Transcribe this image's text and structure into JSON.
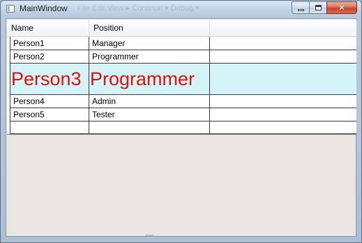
{
  "window": {
    "title": "MainWindow",
    "ghost_toolbar_text": "File  Edit  View  ▸ Continue ▾ Debug ▾",
    "controls": {
      "minimize": "minimize",
      "maximize": "maximize",
      "close": "✕"
    }
  },
  "grid": {
    "columns": [
      "Name",
      "Position",
      ""
    ],
    "rows": [
      {
        "name": "Person1",
        "position": "Manager",
        "extra": "",
        "style": "normal"
      },
      {
        "name": "Person2",
        "position": "Programmer",
        "extra": "",
        "style": "normal"
      },
      {
        "name": "Person3",
        "position": "Programmer",
        "extra": "",
        "style": "large-highlighted",
        "highlight_color": "#d5f4f7",
        "text_color": "#dd1111"
      },
      {
        "name": "Person4",
        "position": "Admin",
        "extra": "",
        "style": "normal"
      },
      {
        "name": "Person5",
        "position": "Tester",
        "extra": "",
        "style": "normal"
      },
      {
        "name": "",
        "position": "",
        "extra": "",
        "style": "new-row"
      }
    ]
  },
  "colors": {
    "accent_row_background": "#d5f4f7",
    "accent_row_text": "#dd1111",
    "close_button": "#c3462b",
    "client_background": "#e9e6e3"
  }
}
